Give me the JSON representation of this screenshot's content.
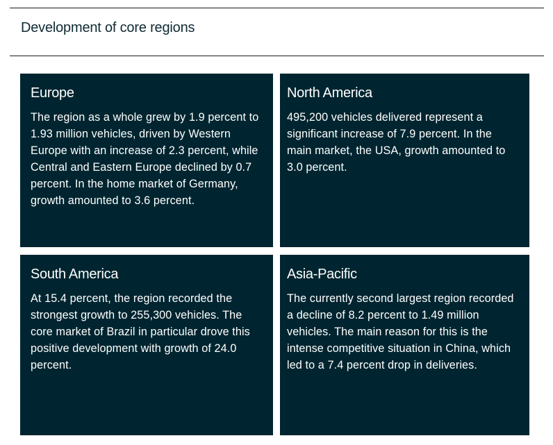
{
  "page": {
    "title": "Development of core regions"
  },
  "colors": {
    "card_background": "#002530",
    "card_text": "#ffffff",
    "heading_text": "#0f2a33",
    "rule": "#1a1a1a"
  },
  "regions": [
    {
      "title": "Europe",
      "text": "The region as a whole grew by 1.9 percent to 1.93 million vehicles, driven by Western Europe with an increase of 2.3 percent, while Central and Eastern Europe declined by 0.7 percent. In the home market of Germany, growth amounted to 3.6 percent."
    },
    {
      "title": "North America",
      "text": "495,200 vehicles delivered represent a significant increase of 7.9 percent. In the main market, the USA, growth amounted to 3.0 percent."
    },
    {
      "title": "South America",
      "text": "At 15.4 percent, the region recorded the strongest growth to 255,300 vehicles. The core market of Brazil in particular drove this positive development with growth of 24.0 percent."
    },
    {
      "title": "Asia-Pacific",
      "text": "The currently second largest region recorded a decline of 8.2 percent to 1.49 million vehicles. The main reason for this is the intense competitive situation in China, which led to a 7.4 percent drop in deliveries."
    }
  ]
}
